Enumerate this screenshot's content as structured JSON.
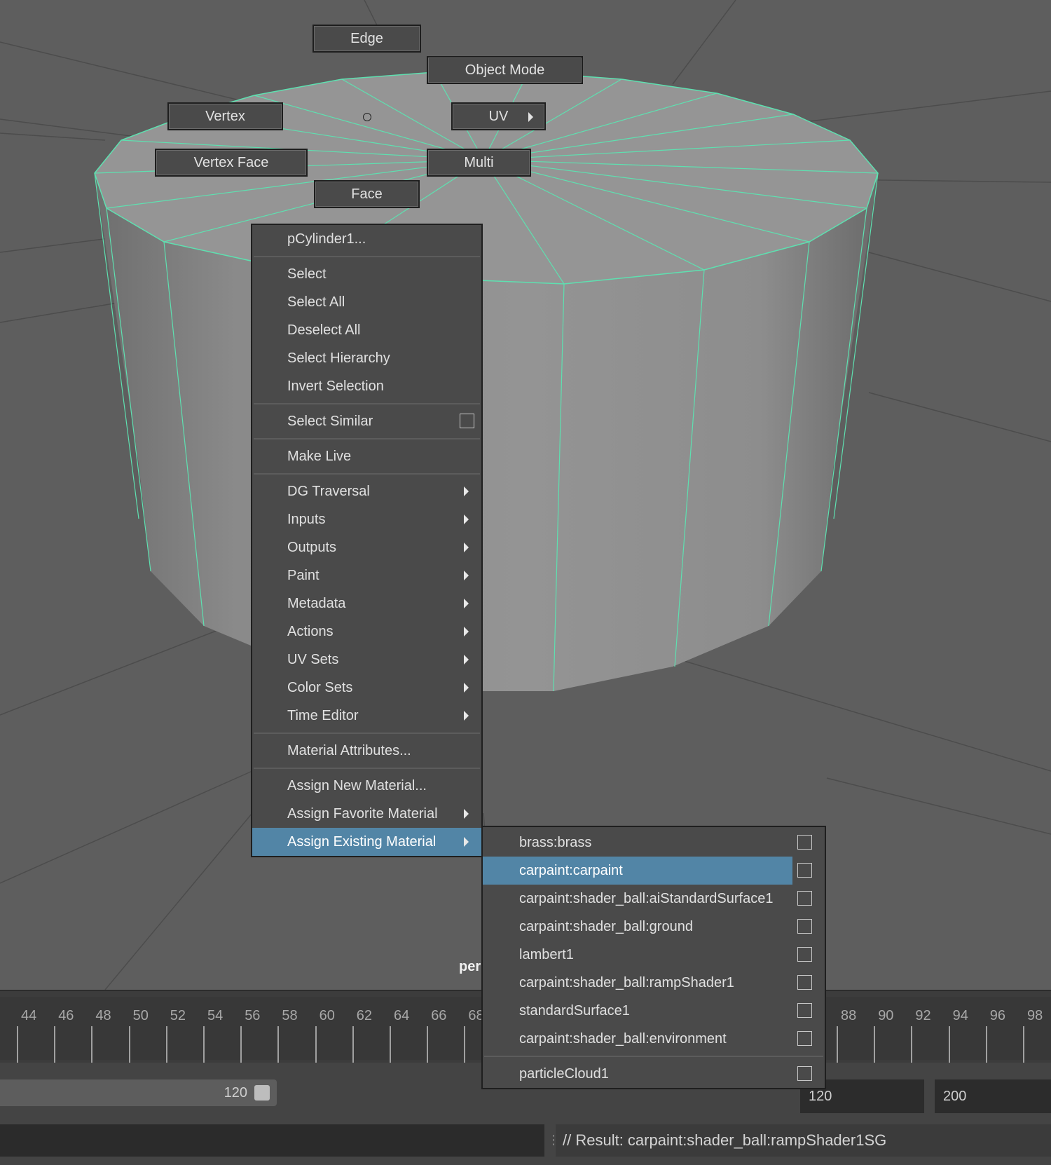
{
  "marking_menu": {
    "edge": "Edge",
    "object_mode": "Object Mode",
    "vertex": "Vertex",
    "uv": "UV",
    "vertex_face": "Vertex Face",
    "multi": "Multi",
    "face": "Face"
  },
  "context_menu": {
    "header": "pCylinder1...",
    "items": {
      "select": "Select",
      "select_all": "Select All",
      "deselect_all": "Deselect All",
      "select_hierarchy": "Select Hierarchy",
      "invert_selection": "Invert Selection",
      "select_similar": "Select Similar",
      "make_live": "Make Live",
      "dg_traversal": "DG Traversal",
      "inputs": "Inputs",
      "outputs": "Outputs",
      "paint": "Paint",
      "metadata": "Metadata",
      "actions": "Actions",
      "uv_sets": "UV Sets",
      "color_sets": "Color Sets",
      "time_editor": "Time Editor",
      "material_attributes": "Material Attributes...",
      "assign_new_material": "Assign New Material...",
      "assign_favorite_material": "Assign Favorite Material",
      "assign_existing_material": "Assign Existing Material"
    }
  },
  "material_submenu": {
    "items": [
      "brass:brass",
      "carpaint:carpaint",
      "carpaint:shader_ball:aiStandardSurface1",
      "carpaint:shader_ball:ground",
      "lambert1",
      "carpaint:shader_ball:rampShader1",
      "standardSurface1",
      "carpaint:shader_ball:environment"
    ],
    "highlighted": "carpaint:carpaint",
    "extra_item": "particleCloud1"
  },
  "viewport": {
    "camera_label": "per"
  },
  "timeline": {
    "ticks": [
      "44",
      "46",
      "48",
      "50",
      "52",
      "54",
      "56",
      "58",
      "60",
      "62",
      "64",
      "66",
      "68",
      "88",
      "90",
      "92",
      "94",
      "96",
      "98"
    ]
  },
  "range": {
    "slider_end": "120",
    "end_time": "120",
    "max_time": "200"
  },
  "command_line": {
    "result": "// Result: carpaint:shader_ball:rampShader1SG"
  },
  "colors": {
    "highlight": "#5285a6",
    "wireframe": "#5ee0b0",
    "menu_bg": "#4a4a4a"
  }
}
